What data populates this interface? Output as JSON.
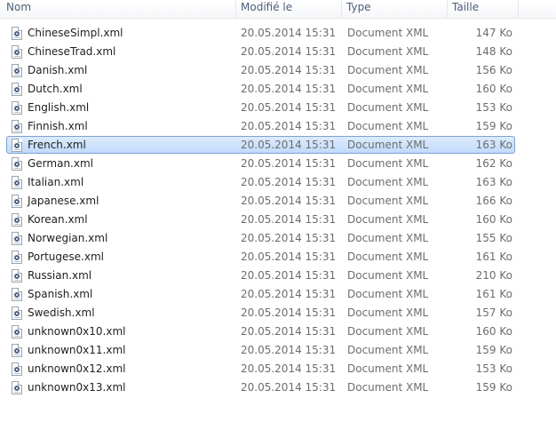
{
  "columns": {
    "name": "Nom",
    "date": "Modifié le",
    "type": "Type",
    "size": "Taille"
  },
  "files": [
    {
      "name": "ChineseSimpl.xml",
      "date": "20.05.2014 15:31",
      "type": "Document XML",
      "size": "147 Ko",
      "icon": "xml-file-icon"
    },
    {
      "name": "ChineseTrad.xml",
      "date": "20.05.2014 15:31",
      "type": "Document XML",
      "size": "148 Ko",
      "icon": "xml-file-icon"
    },
    {
      "name": "Danish.xml",
      "date": "20.05.2014 15:31",
      "type": "Document XML",
      "size": "156 Ko",
      "icon": "xml-file-icon"
    },
    {
      "name": "Dutch.xml",
      "date": "20.05.2014 15:31",
      "type": "Document XML",
      "size": "160 Ko",
      "icon": "xml-file-icon"
    },
    {
      "name": "English.xml",
      "date": "20.05.2014 15:31",
      "type": "Document XML",
      "size": "153 Ko",
      "icon": "xml-file-icon"
    },
    {
      "name": "Finnish.xml",
      "date": "20.05.2014 15:31",
      "type": "Document XML",
      "size": "159 Ko",
      "icon": "xml-file-icon"
    },
    {
      "name": "French.xml",
      "date": "20.05.2014 15:31",
      "type": "Document XML",
      "size": "163 Ko",
      "icon": "xml-file-icon",
      "selected": true
    },
    {
      "name": "German.xml",
      "date": "20.05.2014 15:31",
      "type": "Document XML",
      "size": "162 Ko",
      "icon": "xml-file-icon"
    },
    {
      "name": "Italian.xml",
      "date": "20.05.2014 15:31",
      "type": "Document XML",
      "size": "163 Ko",
      "icon": "xml-file-icon"
    },
    {
      "name": "Japanese.xml",
      "date": "20.05.2014 15:31",
      "type": "Document XML",
      "size": "166 Ko",
      "icon": "xml-file-icon"
    },
    {
      "name": "Korean.xml",
      "date": "20.05.2014 15:31",
      "type": "Document XML",
      "size": "160 Ko",
      "icon": "xml-file-icon"
    },
    {
      "name": "Norwegian.xml",
      "date": "20.05.2014 15:31",
      "type": "Document XML",
      "size": "155 Ko",
      "icon": "xml-file-icon"
    },
    {
      "name": "Portugese.xml",
      "date": "20.05.2014 15:31",
      "type": "Document XML",
      "size": "161 Ko",
      "icon": "xml-file-icon"
    },
    {
      "name": "Russian.xml",
      "date": "20.05.2014 15:31",
      "type": "Document XML",
      "size": "210 Ko",
      "icon": "xml-file-icon"
    },
    {
      "name": "Spanish.xml",
      "date": "20.05.2014 15:31",
      "type": "Document XML",
      "size": "161 Ko",
      "icon": "xml-file-icon"
    },
    {
      "name": "Swedish.xml",
      "date": "20.05.2014 15:31",
      "type": "Document XML",
      "size": "157 Ko",
      "icon": "xml-file-icon"
    },
    {
      "name": "unknown0x10.xml",
      "date": "20.05.2014 15:31",
      "type": "Document XML",
      "size": "160 Ko",
      "icon": "xml-file-icon"
    },
    {
      "name": "unknown0x11.xml",
      "date": "20.05.2014 15:31",
      "type": "Document XML",
      "size": "159 Ko",
      "icon": "xml-file-icon"
    },
    {
      "name": "unknown0x12.xml",
      "date": "20.05.2014 15:31",
      "type": "Document XML",
      "size": "153 Ko",
      "icon": "xml-file-icon"
    },
    {
      "name": "unknown0x13.xml",
      "date": "20.05.2014 15:31",
      "type": "Document XML",
      "size": "159 Ko",
      "icon": "xml-file-icon"
    }
  ],
  "colors": {
    "header_text": "#4c607a",
    "selection_border": "#7da2ce",
    "selection_fill": "#cce2fc",
    "meta_text": "#6d6d6d"
  }
}
